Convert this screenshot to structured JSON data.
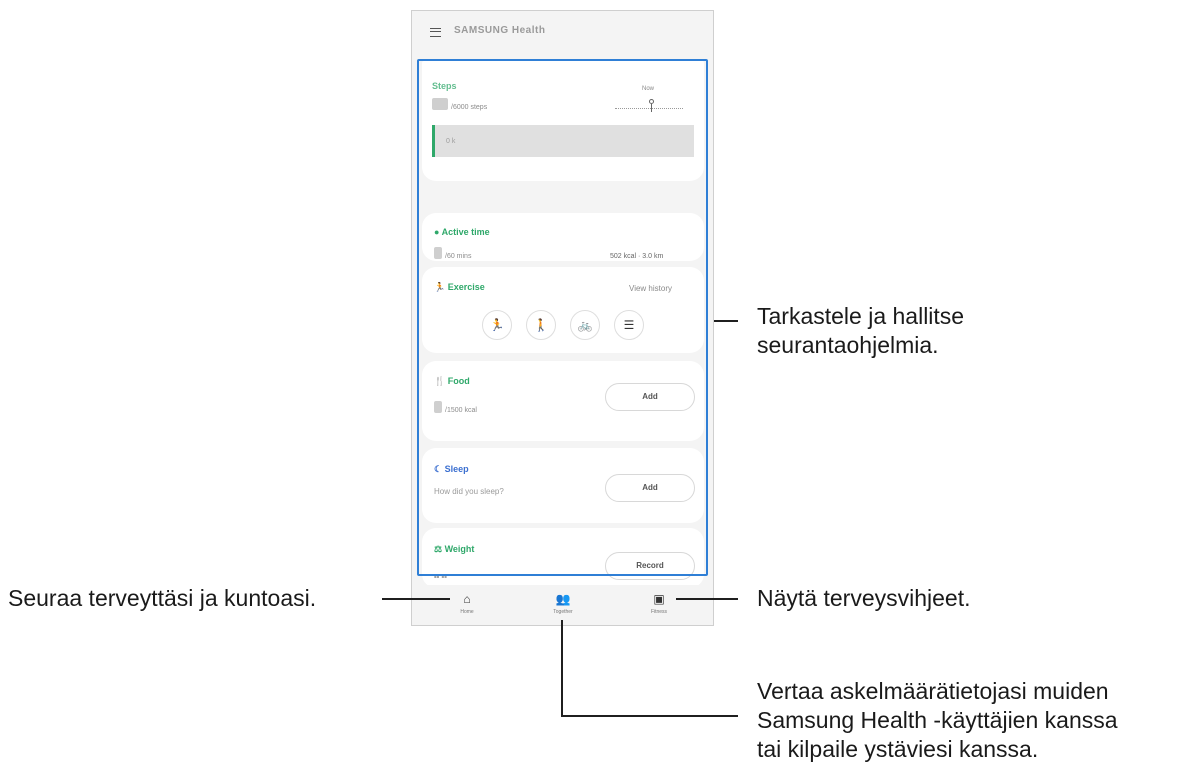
{
  "app": {
    "title": "SAMSUNG Health"
  },
  "cards": {
    "steps": {
      "title": "Steps",
      "goal": "/6000 steps",
      "now_label": "Now",
      "bar_text": "0 k"
    },
    "active_time": {
      "title": "Active time",
      "goal": "/60 mins",
      "stats": "502 kcal · 3.0 km"
    },
    "exercise": {
      "title": "Exercise",
      "link": "View history",
      "buttons": [
        {
          "icon": "running-icon",
          "glyph": "🏃"
        },
        {
          "icon": "walking-icon",
          "glyph": "🚶"
        },
        {
          "icon": "cycling-icon",
          "glyph": "🚲"
        },
        {
          "icon": "list-icon",
          "glyph": "☰"
        }
      ]
    },
    "food": {
      "title": "Food",
      "goal": "/1500 kcal",
      "action": "Add"
    },
    "sleep": {
      "title": "Sleep",
      "prompt": "How did you sleep?",
      "action": "Add"
    },
    "weight": {
      "title": "Weight",
      "value": "-- --",
      "action": "Record"
    }
  },
  "bottom_nav": [
    {
      "label": "Home",
      "icon": "home-icon"
    },
    {
      "label": "Together",
      "icon": "people-icon"
    },
    {
      "label": "Fitness",
      "icon": "fitness-icon"
    }
  ],
  "callouts": {
    "trackers": [
      "Tarkastele ja hallitse",
      "seurantaohjelmia."
    ],
    "home": "Seuraa terveyttäsi ja kuntoasi.",
    "fitness": "Näytä terveysvihjeet.",
    "together": [
      "Vertaa askelmäärätietojasi muiden",
      "Samsung Health -käyttäjien kanssa",
      "tai kilpaile ystäviesi kanssa."
    ]
  },
  "colors": {
    "accent_green": "#2fa86a",
    "highlight_blue": "#2f7fd6"
  }
}
